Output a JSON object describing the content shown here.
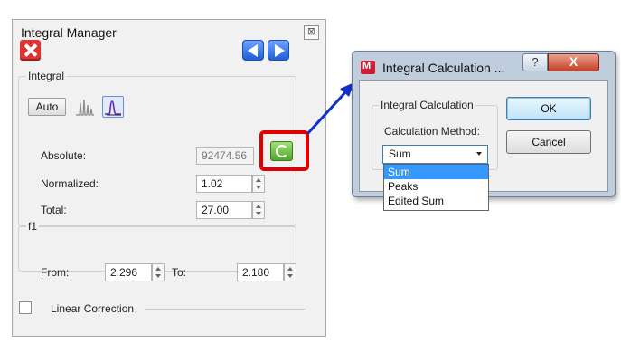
{
  "integral_manager": {
    "title": "Integral Manager",
    "close_glyph": "⊠",
    "integral_group_label": "Integral",
    "auto_label": "Auto",
    "absolute_label": "Absolute:",
    "absolute_value": "92474.56",
    "normalized_label": "Normalized:",
    "normalized_value": "1.02",
    "total_label": "Total:",
    "total_value": "27.00",
    "f1_group_label": "f1",
    "from_label": "From:",
    "from_value": "2.296",
    "to_label": "To:",
    "to_value": "2.180",
    "linear_correction_label": "Linear Correction",
    "linear_correction_checked": false
  },
  "dialog": {
    "title": "Integral Calculation ...",
    "help_glyph": "?",
    "close_glyph": "X",
    "group_label": "Integral Calculation",
    "method_label": "Calculation Method:",
    "method_selected": "Sum",
    "method_options": [
      "Sum",
      "Peaks",
      "Edited Sum"
    ],
    "ok_label": "OK",
    "cancel_label": "Cancel"
  },
  "colors": {
    "highlight": "#e00000",
    "arrow": "#1030c8",
    "selection": "#3399ff",
    "delete_button": "#e23333",
    "nav_button": "#1f5fd6",
    "refresh_button": "#4ea82a"
  },
  "icons": {
    "delete": "delete-icon",
    "previous": "arrow-left-icon",
    "next": "arrow-right-icon",
    "peaks": "peaks-icon",
    "integral": "integral-curve-icon",
    "refresh": "refresh-icon",
    "app": "app-logo-icon"
  }
}
